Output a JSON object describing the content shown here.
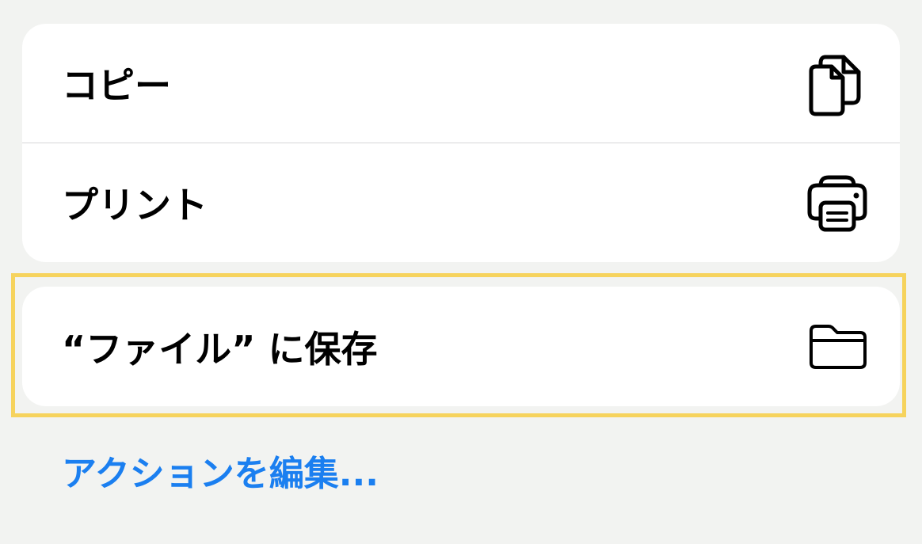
{
  "actions": {
    "items": [
      {
        "label": "コピー",
        "icon": "copy-icon"
      },
      {
        "label": "プリント",
        "icon": "printer-icon"
      }
    ],
    "save_to_files": {
      "label": "“ファイル” に保存",
      "icon": "folder-icon",
      "highlighted": true
    }
  },
  "edit_actions": {
    "label": "アクションを編集..."
  },
  "colors": {
    "background": "#f2f3f1",
    "card": "#ffffff",
    "link": "#1b7ff0",
    "highlight_border": "#f6d35d"
  }
}
